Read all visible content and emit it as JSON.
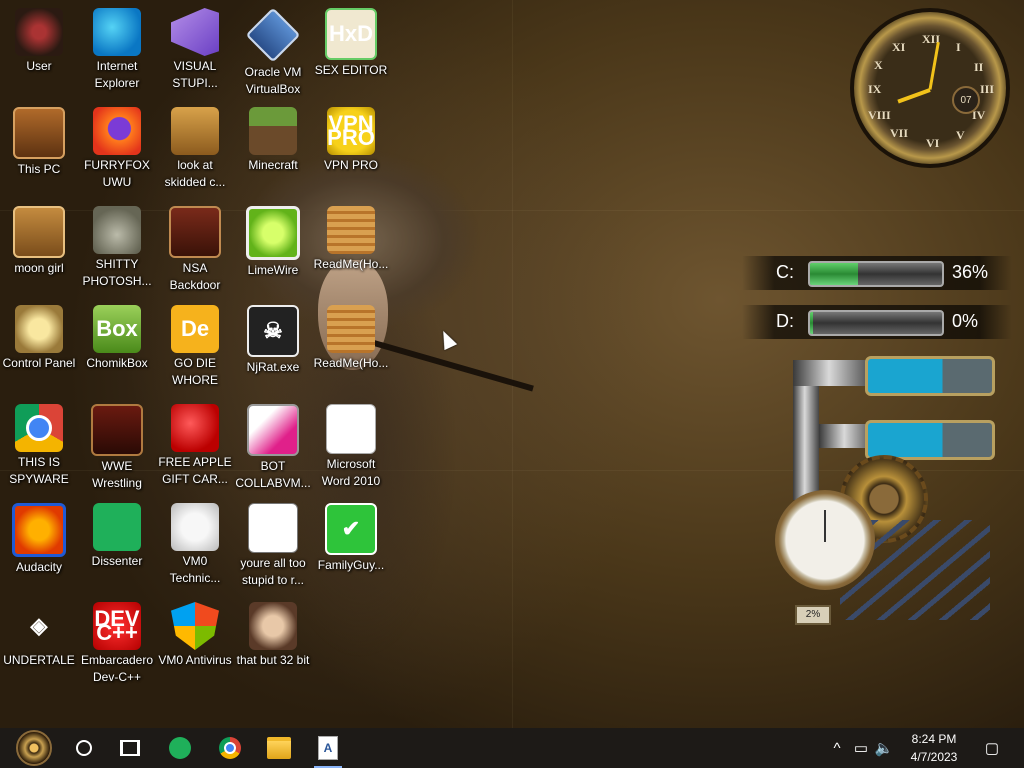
{
  "desktop": {
    "icons": [
      {
        "label": "User"
      },
      {
        "label": "Internet Explorer"
      },
      {
        "label": "VISUAL STUPI..."
      },
      {
        "label": "Oracle VM VirtualBox"
      },
      {
        "label": "SEX EDITOR"
      },
      {
        "label": "This PC"
      },
      {
        "label": "FURRYFOX UWU"
      },
      {
        "label": "look at skidded c..."
      },
      {
        "label": "Minecraft"
      },
      {
        "label": "VPN PRO"
      },
      {
        "label": "moon girl"
      },
      {
        "label": "SHITTY PHOTOSH..."
      },
      {
        "label": "NSA Backdoor"
      },
      {
        "label": "LimeWire"
      },
      {
        "label": "ReadMe(Ho..."
      },
      {
        "label": "Control Panel"
      },
      {
        "label": "ChomikBox"
      },
      {
        "label": "GO DIE WHORE"
      },
      {
        "label": "NjRat.exe"
      },
      {
        "label": "ReadMe(Ho..."
      },
      {
        "label": "THIS IS SPYWARE"
      },
      {
        "label": "WWE Wrestling"
      },
      {
        "label": "FREE APPLE GIFT CAR..."
      },
      {
        "label": "BOT COLLABVM..."
      },
      {
        "label": "Microsoft Word 2010"
      },
      {
        "label": "Audacity"
      },
      {
        "label": "Dissenter"
      },
      {
        "label": "VM0 Technic..."
      },
      {
        "label": "youre all too stupid to r..."
      },
      {
        "label": "FamilyGuy..."
      },
      {
        "label": "UNDERTALE"
      },
      {
        "label": "Embarcadero Dev-C++"
      },
      {
        "label": "VM0 Antivirus"
      },
      {
        "label": "that but 32 bit"
      }
    ],
    "glyphs": {
      "hxd": "HxD",
      "vpn": "VPN PRO",
      "chomik": "Box",
      "die": "De",
      "word": "A",
      "dev": "DEV C++"
    }
  },
  "clock_widget": {
    "numerals": [
      "XII",
      "I",
      "II",
      "III",
      "IV",
      "V",
      "VI",
      "VII",
      "VIII",
      "IX",
      "X",
      "XI"
    ],
    "date": "07"
  },
  "drives": [
    {
      "letter": "C:",
      "percent_text": "36%",
      "percent": 36
    },
    {
      "letter": "D:",
      "percent_text": "0%",
      "percent": 0
    }
  ],
  "gauge": {
    "percent_text": "2%"
  },
  "taskbar": {
    "time": "8:24 PM",
    "date": "4/7/2023",
    "chevron": "^"
  },
  "colors": {
    "taskbar_bg": "#1d1a17",
    "accent": "#8ab4f8",
    "drive_fill": "#3fae4c"
  }
}
